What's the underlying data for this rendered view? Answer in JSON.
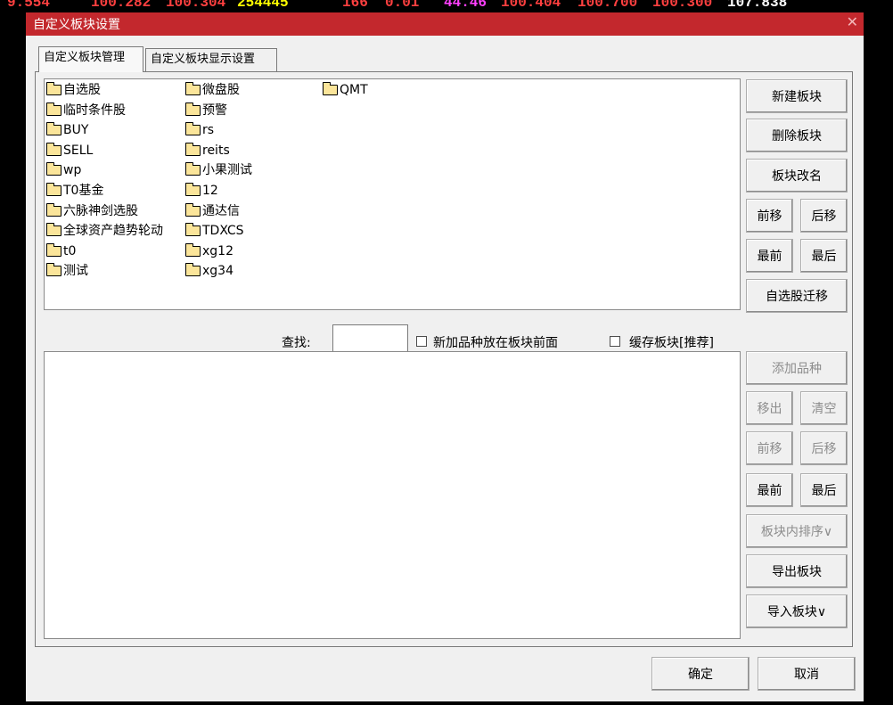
{
  "ticker": [
    {
      "text": "9.554",
      "color": "#ff4040"
    },
    {
      "text": "100.282",
      "color": "#ff4040"
    },
    {
      "text": "100.304",
      "color": "#ff4040"
    },
    {
      "text": "254445",
      "color": "#ffff00"
    },
    {
      "text": "166",
      "color": "#ff4040"
    },
    {
      "text": "0.01",
      "color": "#ff4040"
    },
    {
      "text": "44.46",
      "color": "#ff40ff"
    },
    {
      "text": "100.404",
      "color": "#ff4040"
    },
    {
      "text": "100.700",
      "color": "#ff4040"
    },
    {
      "text": "100.300",
      "color": "#ff4040"
    },
    {
      "text": "107.838",
      "color": "#ffffff"
    }
  ],
  "window": {
    "title": "自定义板块设置",
    "close": "✕"
  },
  "tabs": [
    {
      "label": "自定义板块管理",
      "active": true
    },
    {
      "label": "自定义板块显示设置",
      "active": false
    }
  ],
  "blocks": {
    "col1": [
      "自选股",
      "临时条件股",
      "BUY",
      "SELL",
      "wp",
      "T0基金",
      "六脉神剑选股",
      "全球资产趋势轮动",
      "t0",
      "测试"
    ],
    "col2": [
      "微盘股",
      "预警",
      "rs",
      "reits",
      "小果测试",
      "12",
      "通达信",
      "TDXCS",
      "xg12",
      "xg34"
    ],
    "col3": [
      "QMT"
    ]
  },
  "block_buttons": {
    "new": "新建板块",
    "delete": "删除板块",
    "rename": "板块改名",
    "move_up": "前移",
    "move_down": "后移",
    "first": "最前",
    "last": "最后",
    "migrate": "自选股迁移"
  },
  "search": {
    "label": "查找:",
    "value": ""
  },
  "options": {
    "add_front": {
      "label": "新加品种放在板块前面",
      "checked": false
    },
    "cache": {
      "label": "缓存板块[推荐]",
      "checked": false
    }
  },
  "stock_buttons": {
    "add": "添加品种",
    "remove": "移出",
    "clear": "清空",
    "move_up": "前移",
    "move_down": "后移",
    "first": "最前",
    "last": "最后",
    "sort": "板块内排序∨",
    "export": "导出板块",
    "import": "导入板块∨"
  },
  "footer": {
    "ok": "确定",
    "cancel": "取消"
  }
}
